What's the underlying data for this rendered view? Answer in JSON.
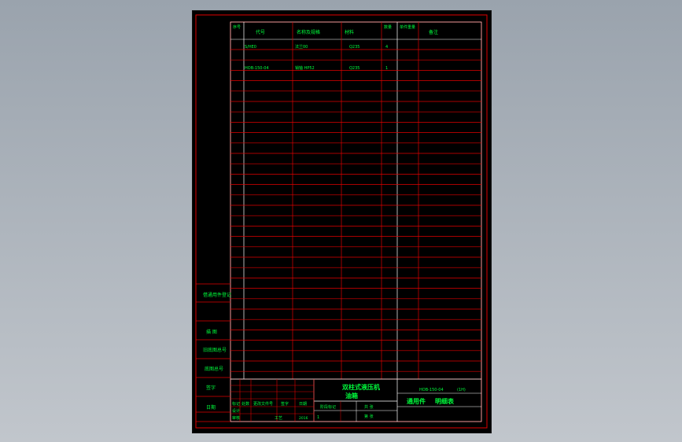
{
  "drawing": {
    "header": {
      "seq": "序号",
      "code": "代号",
      "name": "名称及规格",
      "material": "材料",
      "qty": "数量",
      "unit_weight": "单件重量",
      "remarks": "备注"
    },
    "rows": [
      {
        "code": "S/HE0",
        "name": "法兰00",
        "material": "Q235",
        "qty": "4"
      },
      {
        "code": "HOB-150-04",
        "name": "销轴 HP52",
        "material": "Q235",
        "qty": "1"
      }
    ],
    "left_labels": {
      "stamp": "借通用件登记",
      "trace": "旧底图总号",
      "base": "底图总号",
      "sign": "签字",
      "date": "日期",
      "check": "描 图",
      "verify": "描 校"
    },
    "title_block": {
      "title_line1": "双柱式液压机",
      "title_line2": "油箱",
      "drawing_no": "HOB-150-04",
      "stage": "(1H)",
      "doc_type": "通用件",
      "doc_type2": "明细表",
      "rev_headers": [
        "标记",
        "处数",
        "更改文件号",
        "签字",
        "日期"
      ],
      "design": "设计",
      "check": "审核",
      "std_check": "标准化",
      "process": "工艺",
      "approve": "批准",
      "date_val": "2016",
      "sheets": "共 张",
      "sheet_no": "第 张",
      "stage_label": "阶段标记",
      "scale_val": "1"
    }
  }
}
